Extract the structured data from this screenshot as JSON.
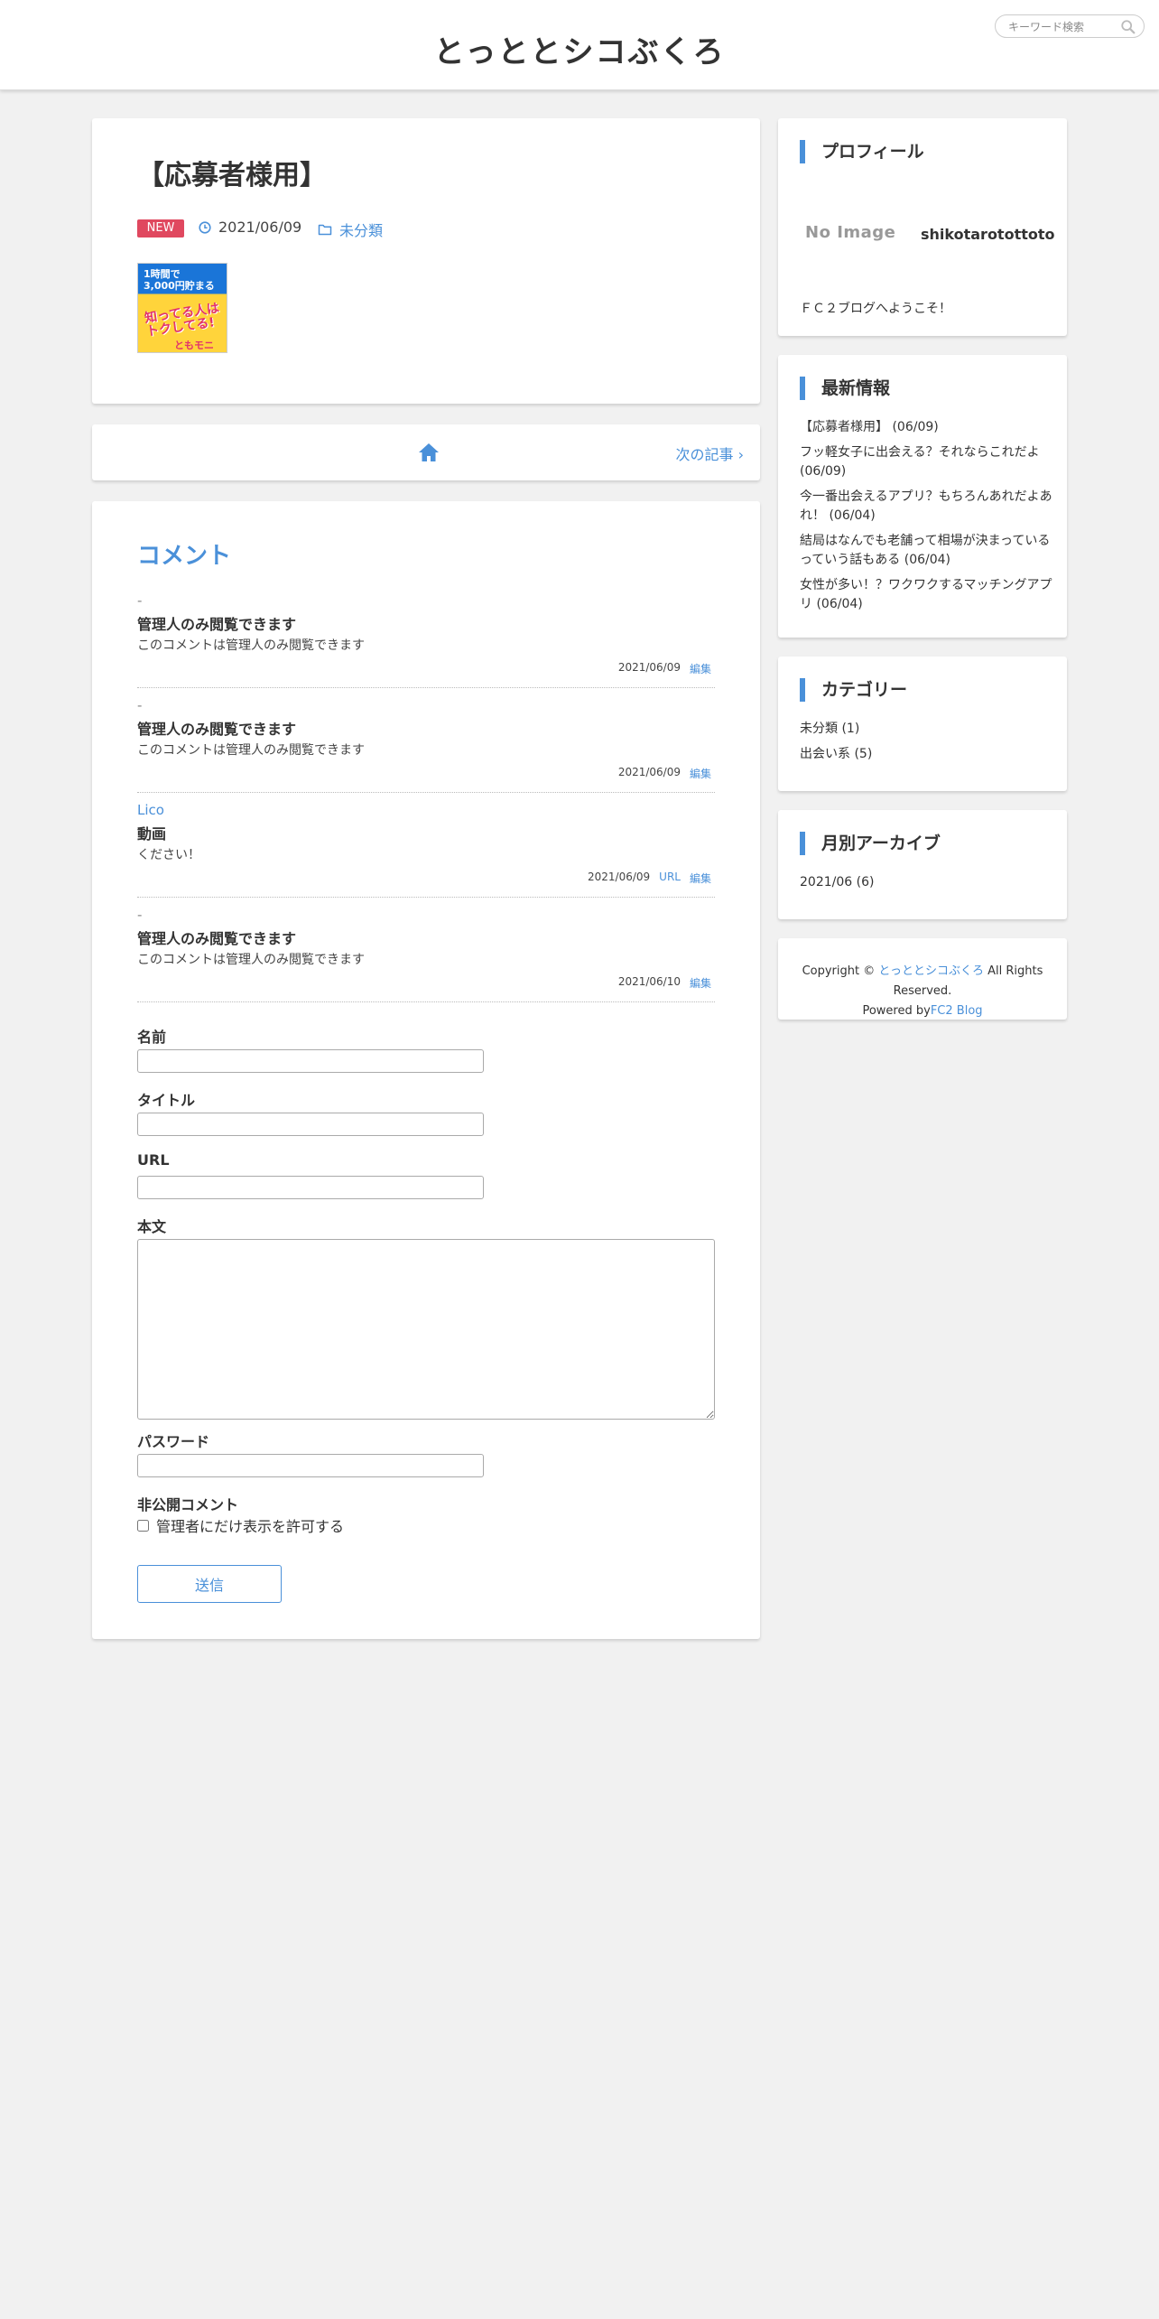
{
  "header": {
    "site_title": "とっととシコぶくろ",
    "search_placeholder": "キーワード検索"
  },
  "post": {
    "title": "【応募者様用】",
    "badge": "NEW",
    "date": "2021/06/09",
    "category": "未分類",
    "banner": {
      "line1": "1時間で",
      "line2": "3,000円貯まる",
      "line3": "知ってる人は",
      "line4": "トクしてる!",
      "brand": "ともモニ"
    }
  },
  "nav": {
    "next_label": "次の記事"
  },
  "comments": {
    "heading": "コメント",
    "items": [
      {
        "author": "-",
        "title": "管理人のみ閲覧できます",
        "body": "このコメントは管理人のみ閲覧できます",
        "date": "2021/06/09",
        "url": "",
        "edit": "編集"
      },
      {
        "author": "-",
        "title": "管理人のみ閲覧できます",
        "body": "このコメントは管理人のみ閲覧できます",
        "date": "2021/06/09",
        "url": "",
        "edit": "編集"
      },
      {
        "author": "Lico",
        "title": "動画",
        "body": "ください！",
        "date": "2021/06/09",
        "url": "URL",
        "edit": "編集"
      },
      {
        "author": "-",
        "title": "管理人のみ閲覧できます",
        "body": "このコメントは管理人のみ閲覧できます",
        "date": "2021/06/10",
        "url": "",
        "edit": "編集"
      }
    ]
  },
  "form": {
    "name_label": "名前",
    "title_label": "タイトル",
    "url_label": "URL",
    "body_label": "本文",
    "password_label": "パスワード",
    "private_label": "非公開コメント",
    "private_check": "管理者にだけ表示を許可する",
    "submit": "送信"
  },
  "sidebar": {
    "profile": {
      "heading": "プロフィール",
      "image_alt": "No Image",
      "name": "shikotarotottoto",
      "desc": "ＦＣ２ブログへようこそ！"
    },
    "recent": {
      "heading": "最新情報",
      "items": [
        "【応募者様用】 (06/09)",
        "フッ軽女子に出会える？それならこれだよ (06/09)",
        "今一番出会えるアプリ？もちろんあれだよあれ！ (06/04)",
        "結局はなんでも老舗って相場が決まっているっていう話もある (06/04)",
        "女性が多い！？ワクワクするマッチングアプリ (06/04)"
      ]
    },
    "categories": {
      "heading": "カテゴリー",
      "items": [
        "未分類 (1)",
        "出会い系 (5)"
      ]
    },
    "archive": {
      "heading": "月別アーカイブ",
      "items": [
        "2021/06 (6)"
      ]
    },
    "footer": {
      "copyright_prefix": "Copyright ©",
      "site_link": "とっととシコぶくろ",
      "rights": "All Rights Reserved.",
      "powered_prefix": "Powered by",
      "powered_link": "FC2 Blog"
    }
  },
  "colors": {
    "accent": "#4a90d9",
    "badge": "#e0485f",
    "background": "#f1f1f1"
  }
}
